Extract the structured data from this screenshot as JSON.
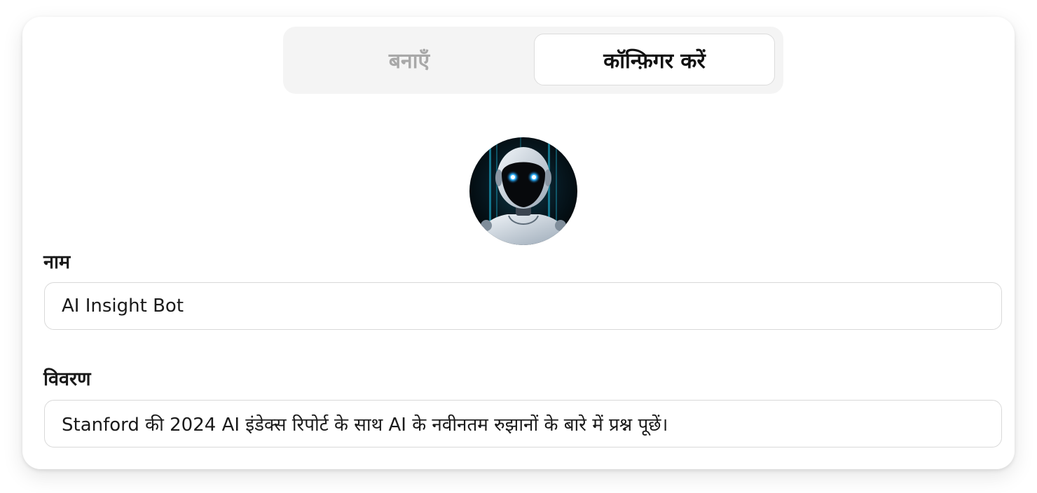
{
  "tabs": {
    "create_label": "बनाएँ",
    "configure_label": "कॉन्फ़िगर करें",
    "active": "configure"
  },
  "avatar": {
    "icon": "robot-avatar-icon"
  },
  "form": {
    "name_label": "नाम",
    "name_value": "AI Insight Bot",
    "description_label": "विवरण",
    "description_value": "Stanford की 2024 AI इंडेक्स रिपोर्ट के साथ AI के नवीनतम रुझानों के बारे में प्रश्न पूछें।"
  },
  "colors": {
    "active_tab_text": "#111111",
    "inactive_tab_text": "#a8a8a8",
    "segmented_bg": "#f4f4f4",
    "robot_eye_glow": "#2fb4ff"
  }
}
